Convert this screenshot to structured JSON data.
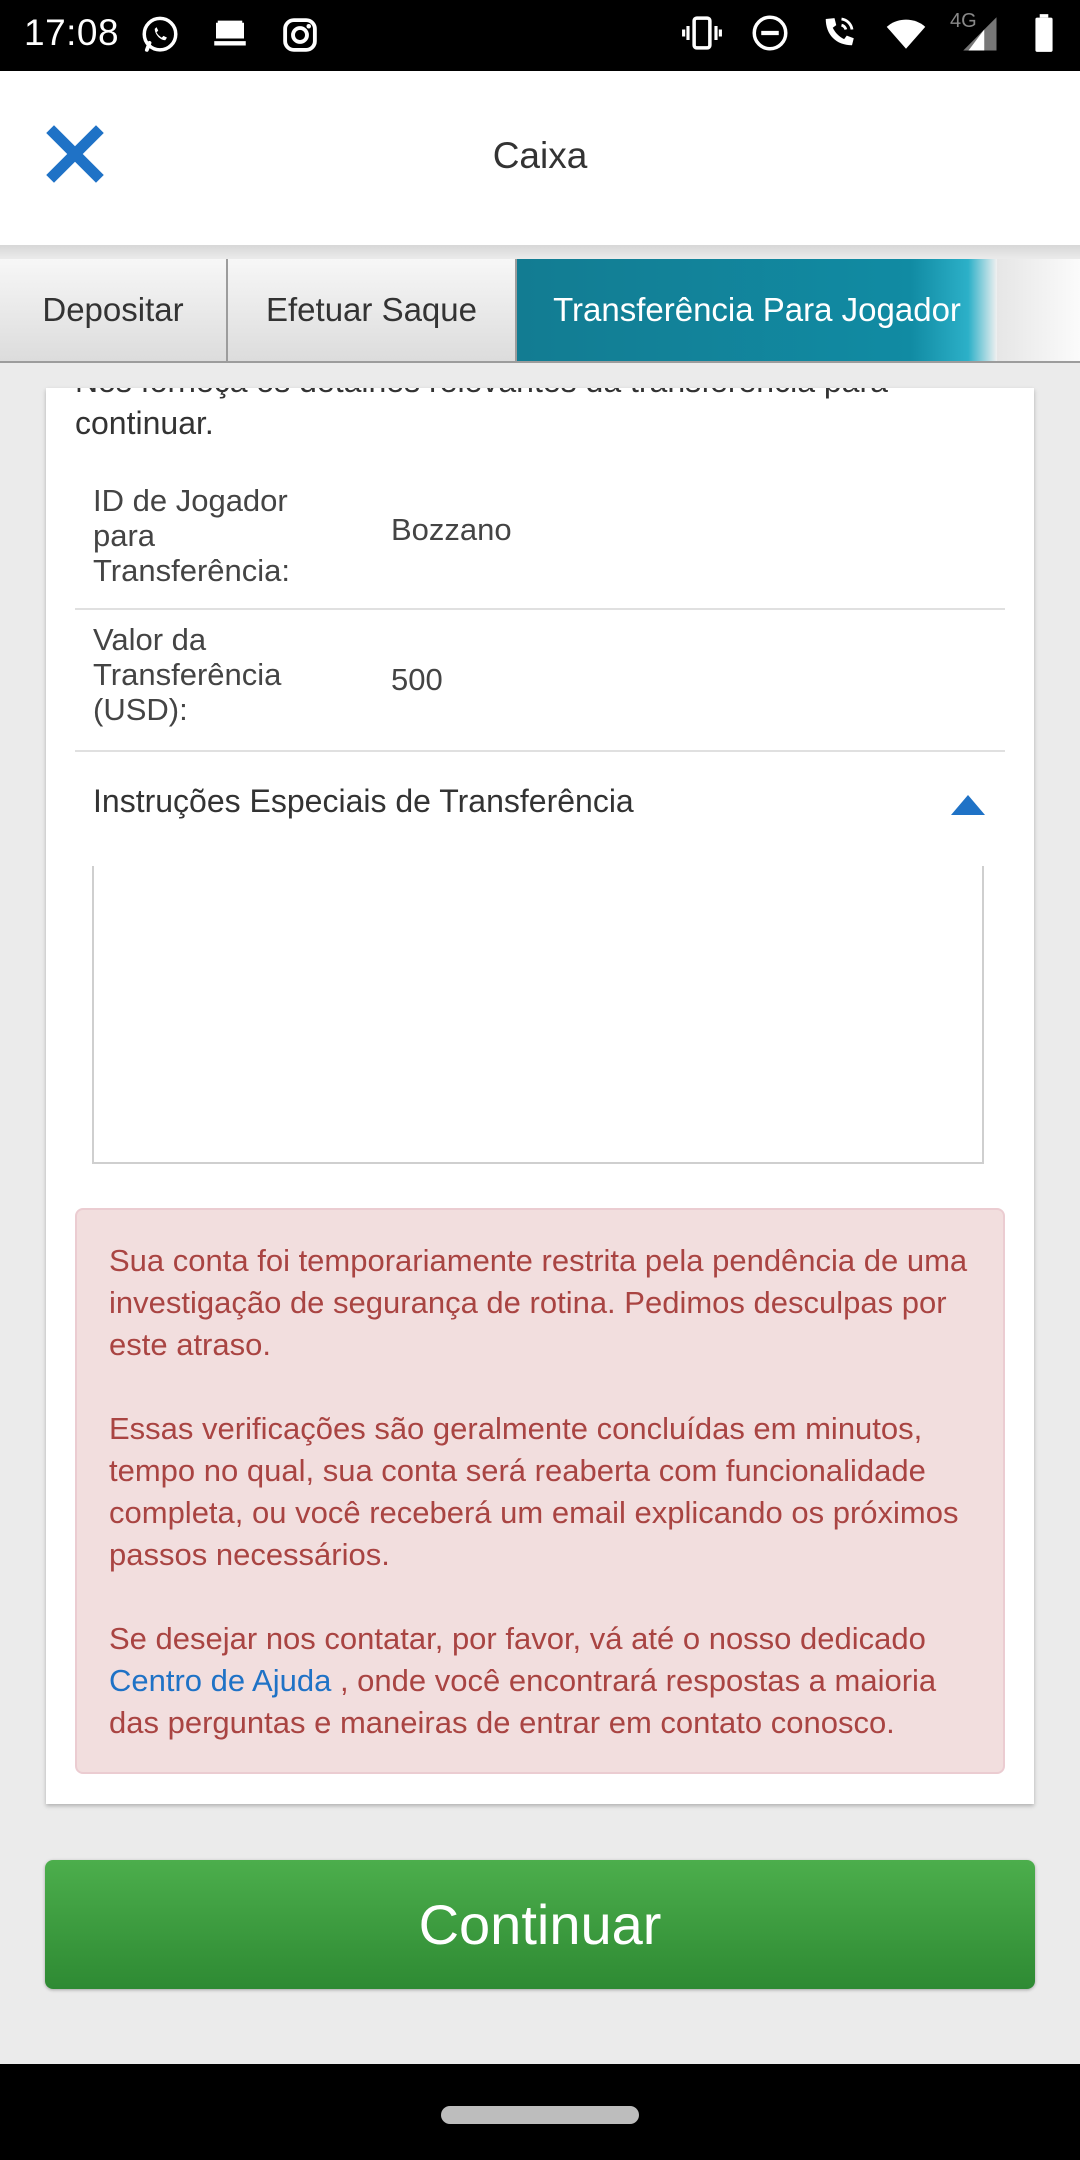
{
  "status_bar": {
    "time": "17:08",
    "network_label": "4G",
    "left_icons": [
      "whatsapp-icon",
      "app-icon",
      "instagram-icon"
    ],
    "right_icons": [
      "vibrate-icon",
      "do-not-disturb-icon",
      "wifi-call-icon",
      "wifi-icon",
      "signal-icon",
      "battery-icon"
    ]
  },
  "header": {
    "title": "Caixa",
    "close_icon": "close-icon",
    "close_color": "#1f72c6"
  },
  "tabs": [
    {
      "label": "Depositar",
      "active": false
    },
    {
      "label": "Efetuar Saque",
      "active": false
    },
    {
      "label": "Transferência Para Jogador",
      "active": true
    },
    {
      "label": "",
      "active": false
    }
  ],
  "form": {
    "intro": "Nos forneça os detalhes relevantes da transferência para continuar.",
    "fields": [
      {
        "label": "ID de Jogador para Transferência:",
        "value": "Bozzano"
      },
      {
        "label": "Valor da Transferência (USD):",
        "value": "500"
      }
    ],
    "special_instructions": {
      "label": "Instruções Especiais de Transferência",
      "value": "",
      "caret_icon": "caret-up-icon"
    }
  },
  "alert": {
    "paragraph1": "Sua conta foi temporariamente restrita pela pendência de uma investigação de segurança de rotina. Pedimos desculpas por este atraso.",
    "paragraph2": "Essas verificações são geralmente concluídas em minutos, tempo no qual, sua conta será reaberta com funcionalidade completa, ou você receberá um email explicando os próximos passos necessários.",
    "paragraph3_before": "Se desejar nos contatar, por favor, vá até o nosso dedicado",
    "help_link": "Centro de Ajuda",
    "paragraph3_after": ", onde você encontrará respostas a maioria das perguntas e maneiras de entrar em contato conosco.",
    "text_color": "#a94442",
    "background_color": "#f2dede"
  },
  "continue_button": {
    "label": "Continuar",
    "color": "#3c9c3f"
  }
}
